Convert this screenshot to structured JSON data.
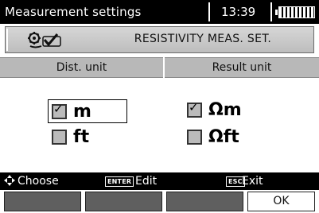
{
  "titlebar": {
    "title": "Measurement settings",
    "time": "13:39",
    "battery_icon": "battery-full-icon"
  },
  "header": {
    "icon": "settings-icon",
    "title": "RESISTIVITY MEAS. SET."
  },
  "columns": {
    "distance_unit_label": "Dist. unit",
    "result_unit_label": "Result unit"
  },
  "distance_unit": {
    "options": [
      {
        "label": "m",
        "checked": true,
        "selected": true
      },
      {
        "label": "ft",
        "checked": false
      }
    ]
  },
  "result_unit": {
    "options": [
      {
        "label": "Ωm",
        "checked": true
      },
      {
        "label": "Ωft",
        "checked": false
      }
    ]
  },
  "hints": {
    "choose_icon": "four-way-arrow-icon",
    "choose": "Choose",
    "enter_key": "ENTER",
    "edit": "Edit",
    "esc_key": "ESC",
    "exit": "Exit"
  },
  "softkeys": {
    "ok": "OK"
  }
}
